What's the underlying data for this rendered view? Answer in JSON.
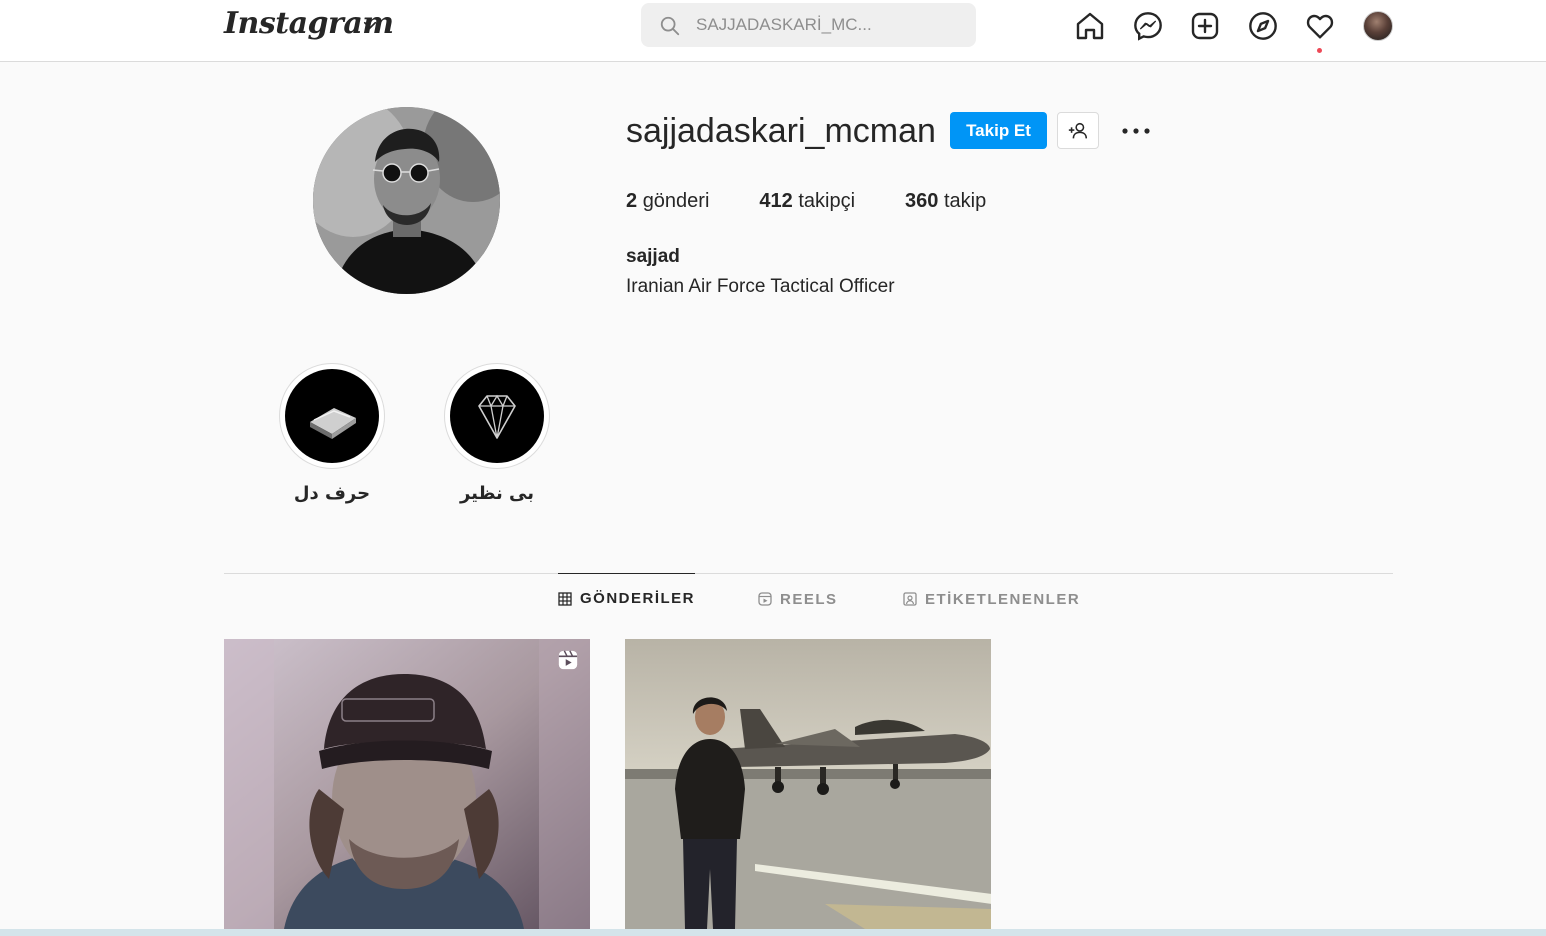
{
  "header": {
    "logo_text": "Instagram",
    "search_placeholder": "SAJJADASKARİ_MC..."
  },
  "nav": {
    "icons": [
      "home-icon",
      "messenger-icon",
      "new-post-icon",
      "explore-icon",
      "activity-heart-icon",
      "profile-avatar"
    ]
  },
  "profile": {
    "username": "sajjadaskari_mcman",
    "follow_label": "Takip Et",
    "stats": [
      {
        "count": "2",
        "label": "gönderi"
      },
      {
        "count": "412",
        "label": "takipçi"
      },
      {
        "count": "360",
        "label": "takip"
      }
    ],
    "full_name": "sajjad",
    "bio": "Iranian Air Force Tactical Officer"
  },
  "highlights": [
    {
      "label": "حرف دل",
      "icon": "book-icon"
    },
    {
      "label": "بی نظیر",
      "icon": "diamond-icon"
    }
  ],
  "tabs": [
    {
      "label": "GÖNDERİLER",
      "icon": "grid-icon",
      "active": true
    },
    {
      "label": "REELS",
      "icon": "reels-icon",
      "active": false
    },
    {
      "label": "ETİKETLENENLER",
      "icon": "tagged-icon",
      "active": false
    }
  ],
  "colors": {
    "accent": "#0095f6",
    "notification": "#ed4956",
    "background": "#fafafa"
  }
}
